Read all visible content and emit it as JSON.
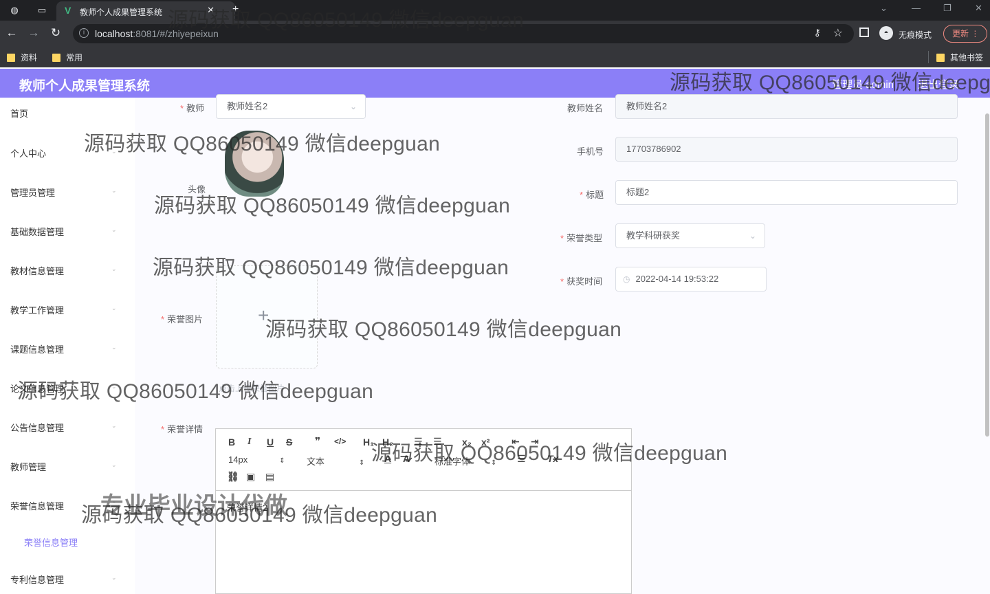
{
  "browser": {
    "tab_title": "教师个人成果管理系统",
    "url_host": "localhost",
    "url_rest": ":8081/#/zhiyepeixun",
    "incognito_label": "无痕模式",
    "update_label": "更新",
    "bookmarks": [
      "资料",
      "常用"
    ],
    "other_bookmarks": "其他书签"
  },
  "header": {
    "title": "教师个人成果管理系统",
    "admin": "管理员 admin",
    "logout": "退出登录"
  },
  "sidebar": {
    "items": [
      "首页",
      "个人中心",
      "管理员管理",
      "基础数据管理",
      "教材信息管理",
      "教学工作管理",
      "课题信息管理",
      "论文信息管理",
      "公告信息管理",
      "教师管理",
      "荣誉信息管理",
      "专利信息管理"
    ],
    "active_sub": "荣誉信息管理"
  },
  "form": {
    "teacher_label": "教师",
    "teacher_value": "教师姓名2",
    "teacher_name_label": "教师姓名",
    "teacher_name_value": "教师姓名2",
    "avatar_label": "头像",
    "phone_label": "手机号",
    "phone_value": "17703786902",
    "title_label": "标题",
    "title_value": "标题2",
    "honor_type_label": "荣誉类型",
    "honor_type_value": "教学科研获奖",
    "award_time_label": "获奖时间",
    "award_time_value": "2022-04-14 19:53:22",
    "honor_image_label": "荣誉图片",
    "upload_tip": "点击上传荣誉图片",
    "honor_detail_label": "荣誉详情",
    "detail_content": "荣誉详情2"
  },
  "editor": {
    "font_size": "14px",
    "paragraph": "文本",
    "font_family": "标准字体"
  },
  "watermarks": {
    "text": "源码获取 QQ86050149 微信deepguan",
    "big": "专业毕业设计代做"
  },
  "icons": {
    "back": "arrow-left-icon",
    "forward": "arrow-right-icon",
    "reload": "reload-icon",
    "key": "key-icon",
    "star": "star-icon",
    "plus": "plus-icon",
    "clock": "clock-icon"
  }
}
